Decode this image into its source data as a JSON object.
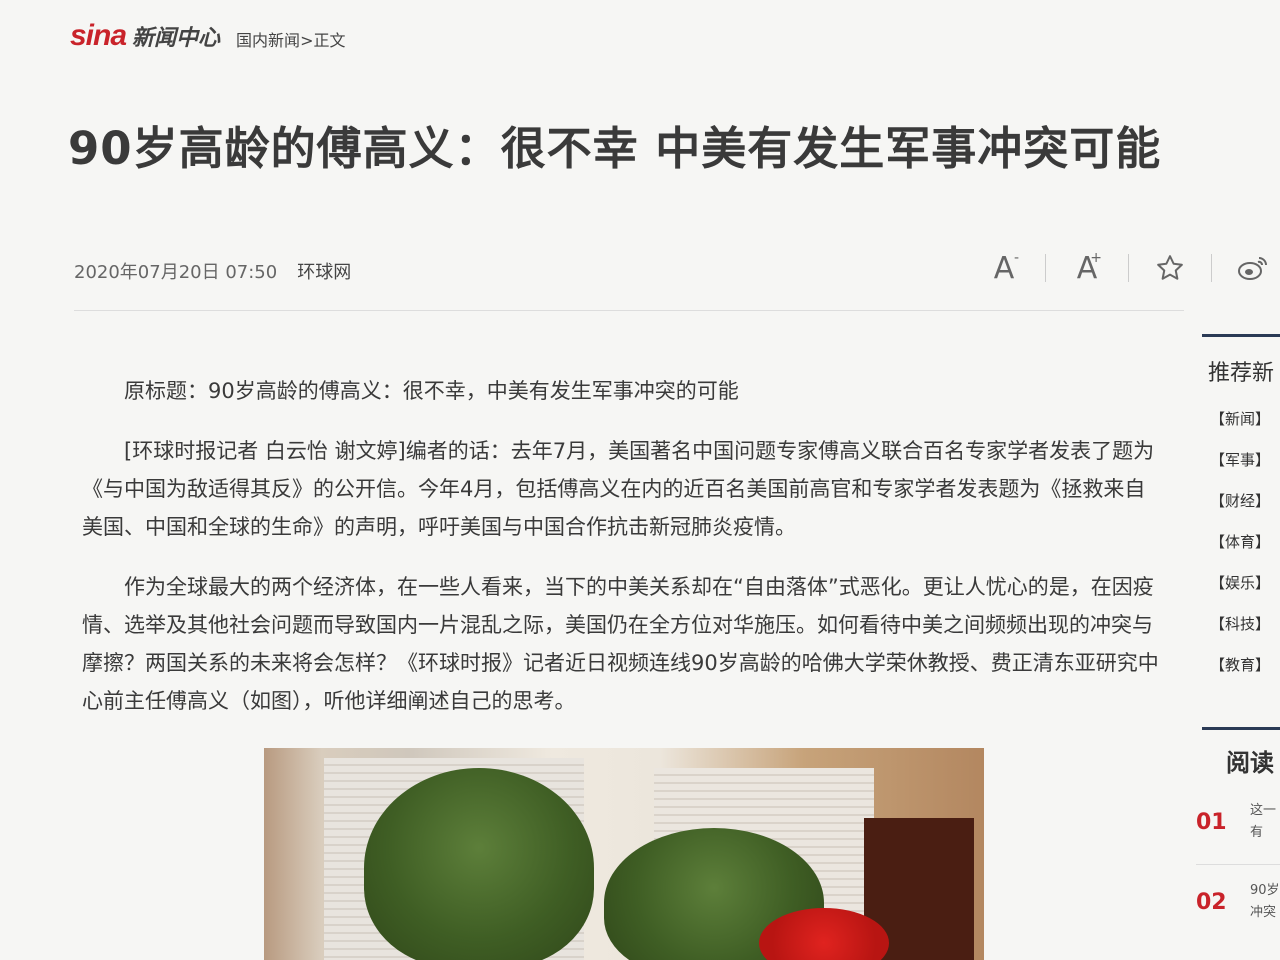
{
  "header": {
    "logo_mark": "sina",
    "logo_text": "新闻中心",
    "breadcrumb": [
      "国内新闻",
      "正文"
    ],
    "breadcrumb_sep": ">"
  },
  "article": {
    "title": "90岁高龄的傅高义：很不幸 中美有发生军事冲突可能",
    "date": "2020年07月20日 07:50",
    "source": "环球网",
    "paragraphs": [
      "原标题：90岁高龄的傅高义：很不幸，中美有发生军事冲突的可能",
      "[环球时报记者 白云怡 谢文婷]编者的话：去年7月，美国著名中国问题专家傅高义联合百名专家学者发表了题为《与中国为敌适得其反》的公开信。今年4月，包括傅高义在内的近百名美国前高官和专家学者发表题为《拯救来自美国、中国和全球的生命》的声明，呼吁美国与中国合作抗击新冠肺炎疫情。",
      "作为全球最大的两个经济体，在一些人看来，当下的中美关系却在“自由落体”式恶化。更让人忧心的是，在因疫情、选举及其他社会问题而导致国内一片混乱之际，美国仍在全方位对华施压。如何看待中美之间频频出现的冲突与摩擦？两国关系的未来将会怎样？《环球时报》记者近日视频连线90岁高龄的哈佛大学荣休教授、费正清东亚研究中心前主任傅高义（如图），听他详细阐述自己的思考。"
    ]
  },
  "toolbar": {
    "font_decrease": "A",
    "font_decrease_mark": "-",
    "font_increase": "A",
    "font_increase_mark": "+",
    "favorite_icon": "star-icon",
    "weibo_icon": "weibo-icon"
  },
  "sidebar": {
    "recommend_title": "推荐新",
    "categories": [
      "【新闻】",
      "【军事】",
      "【财经】",
      "【体育】",
      "【娱乐】",
      "【科技】",
      "【教育】"
    ],
    "reading_title": "阅读",
    "ranking": [
      {
        "rank": "01",
        "lines": [
          "这一",
          "有"
        ]
      },
      {
        "rank": "02",
        "lines": [
          "90岁",
          "冲突"
        ]
      }
    ]
  },
  "colors": {
    "brand_red": "#c9232a",
    "sidebar_accent": "#2b3a55",
    "body_text": "#3a3a3a"
  }
}
